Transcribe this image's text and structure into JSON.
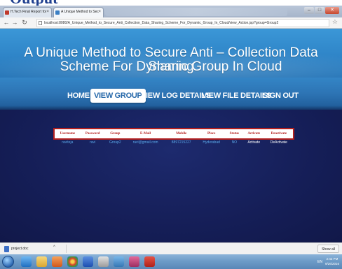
{
  "slide": {
    "heading": "Output"
  },
  "browser": {
    "tabs": [
      {
        "label": "H.Tech Final Report for",
        "active": false
      },
      {
        "label": "A Unique Method to Sec",
        "active": true
      }
    ],
    "url": "localhost:8080/A_Unique_Method_to_Secure_Anti_Collection_Data_Sharing_Scheme_For_Dynamic_Group_In_Cloud/view_Action.jsp?group=Group2",
    "window_controls": {
      "minimize": "–",
      "maximize": "□",
      "close": "✕"
    }
  },
  "page": {
    "title_line1": "A Unique Method to Secure Anti – Collection Data Sharing",
    "title_line2": "Scheme For Dynamic Group In Cloud",
    "nav": [
      {
        "label": "HOME",
        "active": false
      },
      {
        "label": "VIEW GROUP",
        "active": true
      },
      {
        "label": "VIEW LOG DETAILS",
        "active": false
      },
      {
        "label": "VIEW FILE DETAILS",
        "active": false
      },
      {
        "label": "SIGN OUT",
        "active": false
      }
    ],
    "table": {
      "headers": [
        "Username",
        "Password",
        "Group",
        "E-Mail",
        "Mobile",
        "Place",
        "Status",
        "Activate",
        "Deactivate"
      ],
      "rows": [
        [
          "raviteja",
          "ravi",
          "Group2",
          "ravi@gmail.com",
          "8897215227",
          "Hyderabad",
          "NO",
          "Activate",
          "DeActivate"
        ]
      ]
    }
  },
  "downloads": {
    "item": "project.doc",
    "show_all": "Show all"
  },
  "taskbar": {
    "tray_text": "EN",
    "time": "2:42 PM",
    "date": "9/26/2016"
  },
  "colors": {
    "banner": "#3b97d7",
    "page_bg": "#16205a",
    "header_text": "#b3201f",
    "cell_text": "#5aa6e6"
  }
}
